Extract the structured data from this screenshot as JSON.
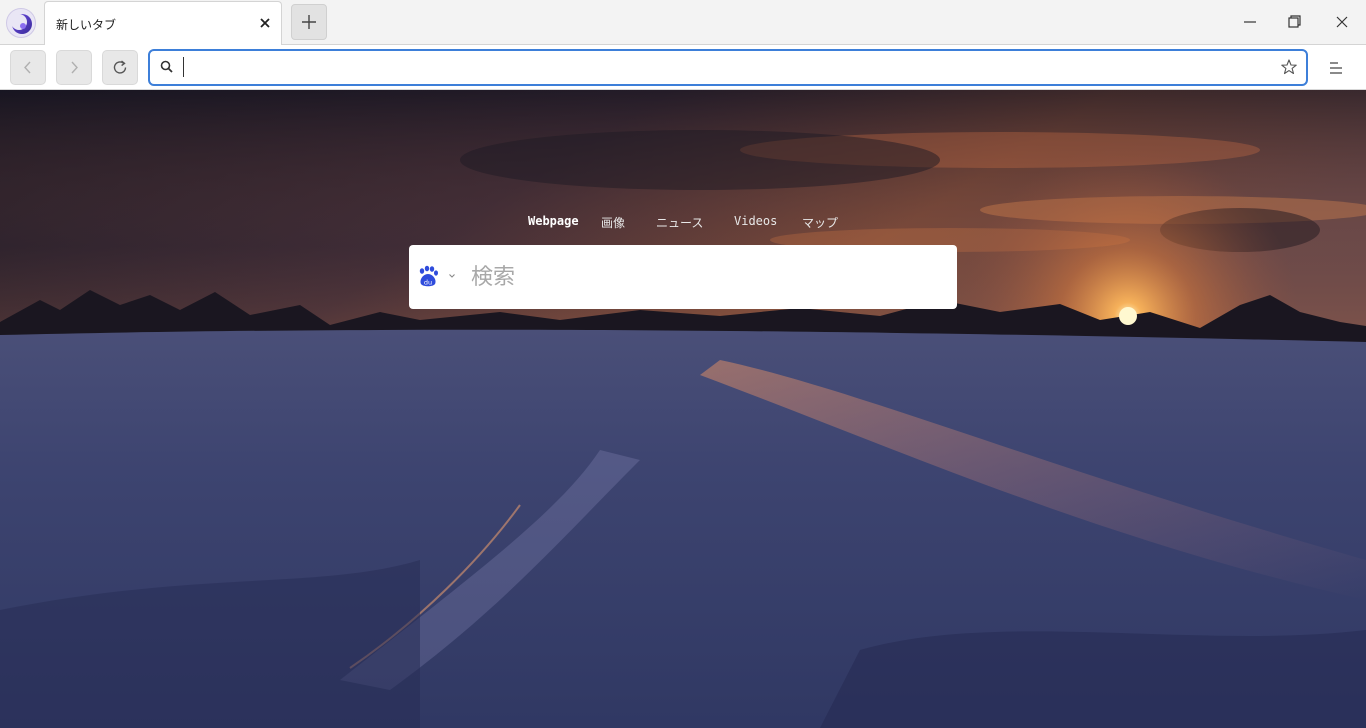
{
  "browser": {
    "tab": {
      "title": "新しいタブ"
    },
    "address_bar": {
      "value": "",
      "placeholder": ""
    },
    "accent_color": "#3d7fd9"
  },
  "new_tab_page": {
    "search_tabs": [
      {
        "label": "Webpage",
        "active": true
      },
      {
        "label": "画像",
        "active": false
      },
      {
        "label": "ニュース",
        "active": false
      },
      {
        "label": "Videos",
        "active": false
      },
      {
        "label": "マップ",
        "active": false
      }
    ],
    "search": {
      "engine_icon": "baidu-paw-icon",
      "placeholder": "検索",
      "value": ""
    },
    "background": "winter-snow-sunset"
  }
}
